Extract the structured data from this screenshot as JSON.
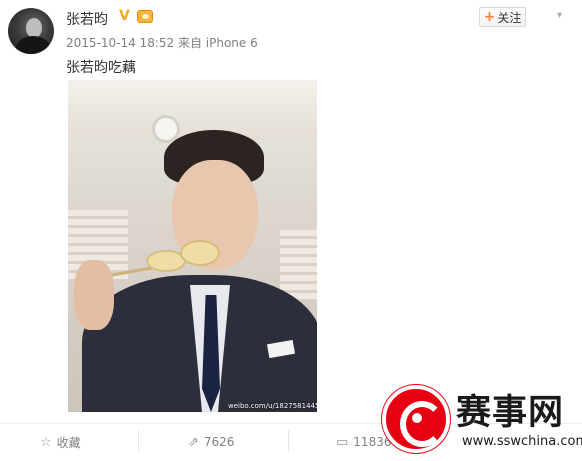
{
  "post": {
    "username": "张若昀",
    "meta": "2015-10-14 18:52 来自 iPhone 6",
    "text": "张若昀吃藕",
    "follow_label": "关注",
    "image_watermark": "weibo.com/u/1827581445"
  },
  "actions": {
    "favorite_label": "收藏",
    "repost_count": "7626",
    "comment_count": "11836"
  },
  "brand": {
    "title": "赛事网",
    "site": "www.sswchina.com"
  },
  "colors": {
    "accent": "#ff8140",
    "brand_red": "#e60012",
    "verified": "#f5a623"
  },
  "icons": [
    "star-icon",
    "repost-icon",
    "comment-icon",
    "verified-icon",
    "vip-icon",
    "chevron-down-icon"
  ]
}
